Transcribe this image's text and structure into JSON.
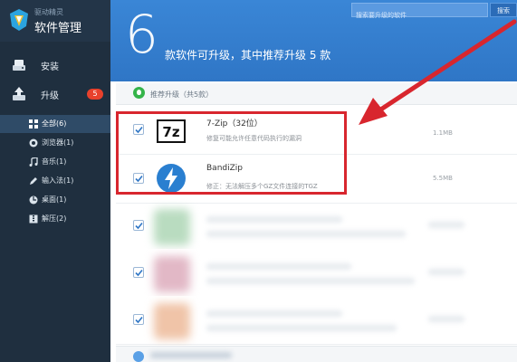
{
  "app": {
    "brand_small": "驱动精灵",
    "title": "软件管理"
  },
  "nav": [
    {
      "label": "安装",
      "icon": "install-icon"
    },
    {
      "label": "升级",
      "icon": "upgrade-icon",
      "badge": "5"
    }
  ],
  "categories": [
    {
      "label": "全部(6)",
      "icon": "grid-icon",
      "active": true
    },
    {
      "label": "浏览器(1)",
      "icon": "browser-icon"
    },
    {
      "label": "音乐(1)",
      "icon": "music-icon"
    },
    {
      "label": "输入法(1)",
      "icon": "pen-icon"
    },
    {
      "label": "桌面(1)",
      "icon": "desktop-icon"
    },
    {
      "label": "解压(2)",
      "icon": "archive-icon"
    }
  ],
  "header": {
    "count": "6",
    "text": "款软件可升级，其中推荐升级 5 款",
    "search_placeholder": "搜索要升级的软件",
    "search_button": "搜索"
  },
  "section": {
    "label": "推荐升级（共5款）"
  },
  "apps": [
    {
      "name": "7-Zip（32位）",
      "desc": "修复可能允许任意代码执行的漏洞",
      "size": "1.1MB",
      "checked": true,
      "icon": "7zip-icon"
    },
    {
      "name": "BandiZip",
      "desc": "修正：无法解压多个GZ文件连接的TGZ",
      "size": "5.5MB",
      "checked": true,
      "icon": "bandizip-icon"
    }
  ],
  "colors": {
    "sidebar": "#1f2f3f",
    "header": "#3a86d6",
    "badge": "#e8412c",
    "annotation": "#d8262e"
  }
}
